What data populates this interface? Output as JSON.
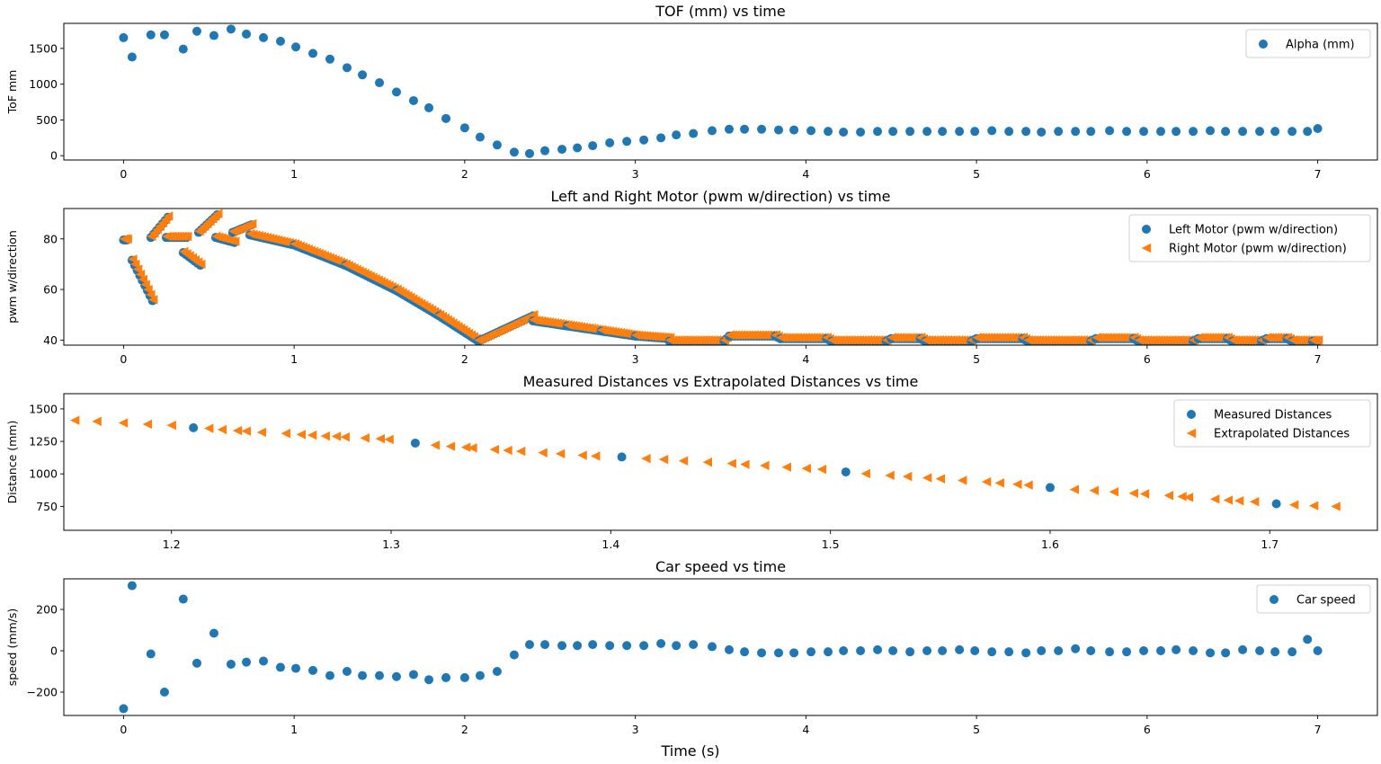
{
  "colors": {
    "blue": "#1f77b4",
    "orange": "#ff7f0e",
    "axis": "#000000",
    "legend_border": "#d0d0d0"
  },
  "figure_xlabel": "Time (s)",
  "chart_data": [
    {
      "type": "scatter",
      "title": "TOF (mm) vs time",
      "xlabel": "",
      "ylabel": "ToF mm",
      "xlim": [
        -0.35,
        7.35
      ],
      "ylim": [
        -60,
        1850
      ],
      "xticks": [
        0,
        1,
        2,
        3,
        4,
        5,
        6,
        7
      ],
      "yticks": [
        0,
        500,
        1000,
        1500
      ],
      "grid": false,
      "legend_position": "top-right",
      "series": [
        {
          "name": "Alpha (mm)",
          "marker": "circle",
          "color": "blue",
          "x": [
            0.0,
            0.05,
            0.16,
            0.24,
            0.35,
            0.43,
            0.53,
            0.63,
            0.72,
            0.82,
            0.92,
            1.01,
            1.11,
            1.21,
            1.31,
            1.4,
            1.5,
            1.6,
            1.7,
            1.79,
            1.89,
            2.0,
            2.09,
            2.19,
            2.29,
            2.38,
            2.47,
            2.57,
            2.66,
            2.75,
            2.85,
            2.95,
            3.05,
            3.15,
            3.24,
            3.34,
            3.45,
            3.55,
            3.64,
            3.74,
            3.84,
            3.93,
            4.03,
            4.13,
            4.22,
            4.32,
            4.42,
            4.51,
            4.61,
            4.71,
            4.8,
            4.9,
            4.99,
            5.09,
            5.19,
            5.29,
            5.38,
            5.48,
            5.58,
            5.67,
            5.78,
            5.88,
            5.98,
            6.08,
            6.17,
            6.27,
            6.37,
            6.46,
            6.56,
            6.66,
            6.75,
            6.85,
            6.94,
            7.0
          ],
          "y": [
            1650,
            1380,
            1690,
            1690,
            1490,
            1740,
            1680,
            1770,
            1700,
            1650,
            1600,
            1520,
            1430,
            1350,
            1230,
            1130,
            1020,
            890,
            770,
            670,
            520,
            390,
            260,
            150,
            50,
            30,
            70,
            90,
            110,
            140,
            180,
            200,
            220,
            250,
            290,
            310,
            350,
            370,
            370,
            370,
            360,
            360,
            350,
            340,
            330,
            330,
            340,
            340,
            340,
            340,
            340,
            340,
            340,
            350,
            340,
            340,
            330,
            340,
            340,
            340,
            350,
            340,
            340,
            340,
            340,
            340,
            350,
            340,
            340,
            340,
            340,
            340,
            340,
            380
          ]
        }
      ]
    },
    {
      "type": "scatter",
      "title": "Left and Right Motor (pwm w/direction) vs time",
      "xlabel": "",
      "ylabel": "pwm w/direction",
      "xlim": [
        -0.35,
        7.35
      ],
      "ylim": [
        38,
        92
      ],
      "xticks": [
        0,
        1,
        2,
        3,
        4,
        5,
        6,
        7
      ],
      "yticks": [
        40,
        60,
        80
      ],
      "grid": false,
      "legend_position": "top-right",
      "segments": [
        {
          "x0": 0.0,
          "x1": 0.02,
          "y0": 80,
          "y1": 80
        },
        {
          "x0": 0.05,
          "x1": 0.17,
          "y0": 72,
          "y1": 56
        },
        {
          "x0": 0.16,
          "x1": 0.26,
          "y0": 81,
          "y1": 89
        },
        {
          "x0": 0.25,
          "x1": 0.37,
          "y0": 81,
          "y1": 81
        },
        {
          "x0": 0.35,
          "x1": 0.45,
          "y0": 75,
          "y1": 70
        },
        {
          "x0": 0.44,
          "x1": 0.55,
          "y0": 83,
          "y1": 90
        },
        {
          "x0": 0.54,
          "x1": 0.65,
          "y0": 81,
          "y1": 79
        },
        {
          "x0": 0.64,
          "x1": 0.75,
          "y0": 83,
          "y1": 86
        },
        {
          "x0": 0.74,
          "x1": 2.08,
          "y0": 82,
          "y1": 40,
          "curve": [
            [
              0.74,
              82
            ],
            [
              1.0,
              78
            ],
            [
              1.3,
              70
            ],
            [
              1.6,
              60
            ],
            [
              1.85,
              50
            ],
            [
              2.08,
              40
            ]
          ]
        },
        {
          "x0": 2.08,
          "x1": 2.4,
          "y0": 40,
          "y1": 50
        },
        {
          "x0": 2.4,
          "x1": 3.2,
          "y0": 48,
          "y1": 41,
          "curve": [
            [
              2.4,
              48
            ],
            [
              2.6,
              46
            ],
            [
              2.8,
              44
            ],
            [
              3.0,
              42
            ],
            [
              3.2,
              41
            ]
          ]
        },
        {
          "x0": 3.2,
          "x1": 7.0,
          "y0": 40,
          "y1": 40,
          "steps": [
            [
              3.2,
              40
            ],
            [
              3.55,
              42
            ],
            [
              3.85,
              41
            ],
            [
              4.15,
              40
            ],
            [
              4.5,
              41
            ],
            [
              4.7,
              40
            ],
            [
              5.0,
              41
            ],
            [
              5.3,
              40
            ],
            [
              5.7,
              41
            ],
            [
              5.95,
              40
            ],
            [
              6.3,
              41
            ],
            [
              6.5,
              40
            ],
            [
              6.7,
              41
            ],
            [
              6.85,
              40
            ],
            [
              7.0,
              40
            ]
          ]
        }
      ],
      "series": [
        {
          "name": "Left Motor (pwm w/direction)",
          "marker": "circle",
          "color": "blue"
        },
        {
          "name": "Right Motor (pwm w/direction)",
          "marker": "triangle-left",
          "color": "orange"
        }
      ]
    },
    {
      "type": "scatter",
      "title": "Measured Distances vs Extrapolated Distances vs time",
      "xlabel": "",
      "ylabel": "Distance (mm)",
      "xlim": [
        1.151,
        1.749
      ],
      "ylim": [
        566,
        1617
      ],
      "xticks": [
        1.2,
        1.3,
        1.4,
        1.5,
        1.6,
        1.7
      ],
      "yticks": [
        750,
        1000,
        1250,
        1500
      ],
      "grid": false,
      "legend_position": "top-right",
      "series": [
        {
          "name": "Measured Distances",
          "marker": "circle",
          "color": "blue",
          "x": [
            1.21,
            1.311,
            1.405,
            1.507,
            1.6,
            1.703
          ],
          "y": [
            1355,
            1237,
            1130,
            1015,
            895,
            770
          ]
        },
        {
          "name": "Extrapolated Distances",
          "marker": "triangle-left",
          "color": "orange",
          "x": [
            1.156,
            1.166,
            1.178,
            1.189,
            1.2,
            1.217,
            1.223,
            1.23,
            1.234,
            1.241,
            1.252,
            1.259,
            1.264,
            1.27,
            1.275,
            1.279,
            1.288,
            1.295,
            1.299,
            1.32,
            1.327,
            1.334,
            1.337,
            1.347,
            1.353,
            1.359,
            1.369,
            1.377,
            1.387,
            1.393,
            1.416,
            1.424,
            1.433,
            1.444,
            1.455,
            1.461,
            1.47,
            1.48,
            1.489,
            1.496,
            1.516,
            1.527,
            1.535,
            1.544,
            1.55,
            1.56,
            1.571,
            1.577,
            1.585,
            1.59,
            1.611,
            1.62,
            1.629,
            1.638,
            1.643,
            1.654,
            1.66,
            1.663,
            1.675,
            1.681,
            1.686,
            1.693,
            1.711,
            1.72,
            1.73
          ],
          "y": [
            1412,
            1404,
            1392,
            1382,
            1374,
            1350,
            1341,
            1333,
            1329,
            1320,
            1311,
            1303,
            1298,
            1291,
            1289,
            1284,
            1276,
            1270,
            1265,
            1221,
            1212,
            1205,
            1200,
            1188,
            1181,
            1174,
            1163,
            1155,
            1143,
            1137,
            1118,
            1111,
            1100,
            1090,
            1080,
            1073,
            1064,
            1052,
            1042,
            1035,
            1002,
            988,
            980,
            970,
            962,
            950,
            939,
            930,
            920,
            914,
            880,
            872,
            862,
            851,
            846,
            834,
            826,
            820,
            806,
            798,
            793,
            786,
            762,
            755,
            750
          ]
        }
      ]
    },
    {
      "type": "scatter",
      "title": "Car speed vs time",
      "xlabel": "Time (s)",
      "ylabel": "speed (mm/s)",
      "xlim": [
        -0.35,
        7.35
      ],
      "ylim": [
        -313,
        348
      ],
      "xticks": [
        0,
        1,
        2,
        3,
        4,
        5,
        6,
        7
      ],
      "yticks": [
        -200,
        0,
        200
      ],
      "grid": false,
      "legend_position": "top-right",
      "series": [
        {
          "name": "Car speed",
          "marker": "circle",
          "color": "blue",
          "x": [
            0.0,
            0.05,
            0.16,
            0.24,
            0.35,
            0.43,
            0.53,
            0.63,
            0.72,
            0.82,
            0.92,
            1.01,
            1.11,
            1.21,
            1.31,
            1.4,
            1.5,
            1.6,
            1.7,
            1.79,
            1.89,
            2.0,
            2.09,
            2.19,
            2.29,
            2.38,
            2.47,
            2.57,
            2.66,
            2.75,
            2.85,
            2.95,
            3.05,
            3.15,
            3.24,
            3.34,
            3.45,
            3.55,
            3.64,
            3.74,
            3.84,
            3.93,
            4.03,
            4.13,
            4.22,
            4.32,
            4.42,
            4.51,
            4.61,
            4.71,
            4.8,
            4.9,
            4.99,
            5.09,
            5.19,
            5.29,
            5.38,
            5.48,
            5.58,
            5.67,
            5.78,
            5.88,
            5.98,
            6.08,
            6.17,
            6.27,
            6.37,
            6.46,
            6.56,
            6.66,
            6.75,
            6.85,
            6.94,
            7.0
          ],
          "y": [
            -280,
            315,
            -15,
            -200,
            250,
            -60,
            85,
            -65,
            -55,
            -50,
            -80,
            -85,
            -95,
            -120,
            -100,
            -120,
            -120,
            -125,
            -115,
            -140,
            -130,
            -130,
            -120,
            -100,
            -20,
            30,
            30,
            25,
            25,
            30,
            25,
            25,
            25,
            35,
            25,
            30,
            20,
            5,
            -5,
            -10,
            -10,
            -10,
            -5,
            -5,
            0,
            0,
            5,
            0,
            -5,
            0,
            0,
            5,
            0,
            -5,
            -5,
            -10,
            0,
            0,
            10,
            0,
            -5,
            -5,
            0,
            0,
            5,
            0,
            -10,
            -10,
            5,
            0,
            -5,
            -5,
            55,
            0
          ]
        }
      ]
    }
  ]
}
